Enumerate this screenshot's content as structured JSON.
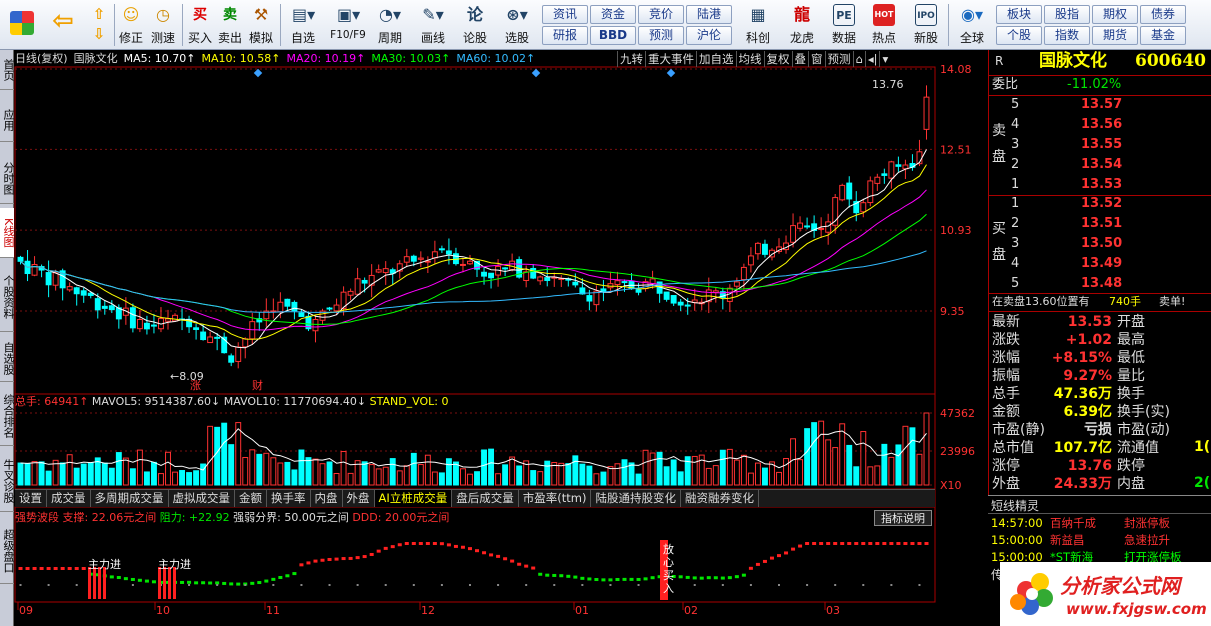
{
  "toolbar": {
    "buttons": [
      {
        "label": "",
        "icon": "windows-icon"
      },
      {
        "label": "",
        "icon": "back-arrow-icon"
      },
      {
        "label": "",
        "icon": "up-down-arrow-icon"
      },
      {
        "label": "修正",
        "icon": "smile-icon"
      },
      {
        "label": "测速",
        "icon": "clock-icon"
      },
      {
        "label": "买入",
        "icon": "buy-icon"
      },
      {
        "label": "卖出",
        "icon": "sell-icon"
      },
      {
        "label": "模拟",
        "icon": "hammer-icon"
      },
      {
        "label": "自选",
        "icon": "folder-icon"
      },
      {
        "label": "F10/F9",
        "icon": "window-icon"
      },
      {
        "label": "周期",
        "icon": "cycle-icon"
      },
      {
        "label": "画线",
        "icon": "pen-icon"
      },
      {
        "label": "论股",
        "icon": "chat-icon"
      },
      {
        "label": "选股",
        "icon": "search-chart-icon"
      },
      {
        "label": "科创",
        "icon": "chart-icon"
      },
      {
        "label": "龙虎",
        "icon": "dragon-icon"
      },
      {
        "label": "数据",
        "icon": "pe-icon"
      },
      {
        "label": "热点",
        "icon": "hot-icon"
      },
      {
        "label": "新股",
        "icon": "ipo-icon"
      },
      {
        "label": "全球",
        "icon": "globe-icon"
      }
    ],
    "quick": [
      "资讯",
      "资金",
      "竞价",
      "陆港",
      "研报",
      "BBD",
      "预测",
      "沪伦",
      "板块",
      "股指",
      "期权",
      "债券",
      "个股",
      "指数",
      "期货",
      "基金"
    ],
    "icons_text": {
      "buy": "买",
      "sell": "卖",
      "chat": "论",
      "pe": "PE",
      "hot": "HOT",
      "ipo": "IPO"
    }
  },
  "left_tabs": [
    "首页",
    "应用",
    "分时图",
    "K线图",
    "个股资料",
    "自选股",
    "综合排名",
    "牛叉诊股",
    "超级盘口"
  ],
  "chart_info": {
    "mode": "日线(复权)",
    "name": "国脉文化",
    "ma5": "MA5: 10.70↑",
    "ma10": "MA10: 10.58↑",
    "ma20": "MA20: 10.19↑",
    "ma30": "MA30: 10.03↑",
    "ma60": "MA60: 10.02↑"
  },
  "chart_tools": [
    "九转",
    "重大事件",
    "加自选",
    "均线",
    "复权",
    "叠",
    "窗",
    "预测",
    "⌂",
    "◂|",
    "▾"
  ],
  "price_axis": [
    "14.08",
    "12.51",
    "10.93",
    "9.35"
  ],
  "chart_marks": {
    "high": "13.76",
    "low": "8.09",
    "m1": "涨",
    "m2": "财"
  },
  "vol_info": {
    "total": "总手: 64941↑",
    "mavol5": "MAVOL5: 9514387.60↓",
    "mavol10": "MAVOL10: 11770694.40↓",
    "stand": "STAND_VOL: 0"
  },
  "vol_axis": [
    "47362",
    "23996",
    "X10"
  ],
  "sub_tabs": [
    "设置",
    "成交量",
    "多周期成交量",
    "虚拟成交量",
    "金额",
    "换手率",
    "内盘",
    "外盘",
    "AI立桩成交量",
    "盘后成交量",
    "市盈率(ttm)",
    "陆股通持股变化",
    "融资融券变化"
  ],
  "ind_info": {
    "name": "强势波段",
    "support": "支撑: 22.06元之间",
    "resist": "阻力: +22.92",
    "strength": "强弱分界: 50.00元之间",
    "ddd": "DDD: 20.00元之间"
  },
  "ind_btn": "指标说明",
  "ind_marks": [
    "主力进",
    "主力进",
    "放心买入"
  ],
  "x_axis": [
    "09",
    "10",
    "11",
    "12",
    "01",
    "02",
    "03"
  ],
  "stock": {
    "flag": "R",
    "name": "国脉文化",
    "code": "600640"
  },
  "wei_bi": {
    "label": "委比",
    "value": "-11.02%"
  },
  "sell_label": "卖盘",
  "buy_label": "买盘",
  "asks": [
    {
      "lvl": "5",
      "price": "13.57"
    },
    {
      "lvl": "4",
      "price": "13.56"
    },
    {
      "lvl": "3",
      "price": "13.55"
    },
    {
      "lvl": "2",
      "price": "13.54"
    },
    {
      "lvl": "1",
      "price": "13.53"
    }
  ],
  "bids": [
    {
      "lvl": "1",
      "price": "13.52"
    },
    {
      "lvl": "2",
      "price": "13.51"
    },
    {
      "lvl": "3",
      "price": "13.50"
    },
    {
      "lvl": "4",
      "price": "13.49"
    },
    {
      "lvl": "5",
      "price": "13.48"
    }
  ],
  "pos_note": {
    "text": "在卖盘13.60位置有",
    "qty": "740手",
    "tag": "卖单!"
  },
  "quote": [
    {
      "l": "最新",
      "v": "13.53",
      "r": "开盘"
    },
    {
      "l": "涨跌",
      "v": "+1.02",
      "r": "最高"
    },
    {
      "l": "涨幅",
      "v": "+8.15%",
      "r": "最低"
    },
    {
      "l": "振幅",
      "v": "9.27%",
      "r": "量比"
    },
    {
      "l": "总手",
      "v": "47.36万",
      "r": "换手"
    },
    {
      "l": "金额",
      "v": "6.39亿",
      "r": "换手(实)"
    },
    {
      "l": "市盈(静)",
      "v": "亏损",
      "r": "市盈(动)"
    },
    {
      "l": "总市值",
      "v": "107.7亿",
      "r": "流通值"
    },
    {
      "l": "涨停",
      "v": "13.76",
      "r": "跌停"
    },
    {
      "l": "外盘",
      "v": "24.33万",
      "r": "内盘"
    }
  ],
  "quote_cut": {
    "liutong": "1(",
    "neipan": "2("
  },
  "news_title": "短线精灵",
  "news": [
    {
      "t": "14:57:00",
      "s": "百纳千成",
      "e": "封涨停板"
    },
    {
      "t": "15:00:00",
      "s": "新益昌",
      "e": "急速拉升"
    },
    {
      "t": "15:00:00",
      "s": "*ST新海",
      "e": "打开涨停板"
    }
  ],
  "news_bottom": "传",
  "logo": {
    "title": "分析家公式网",
    "url": "www.fxjgsw.com"
  }
}
